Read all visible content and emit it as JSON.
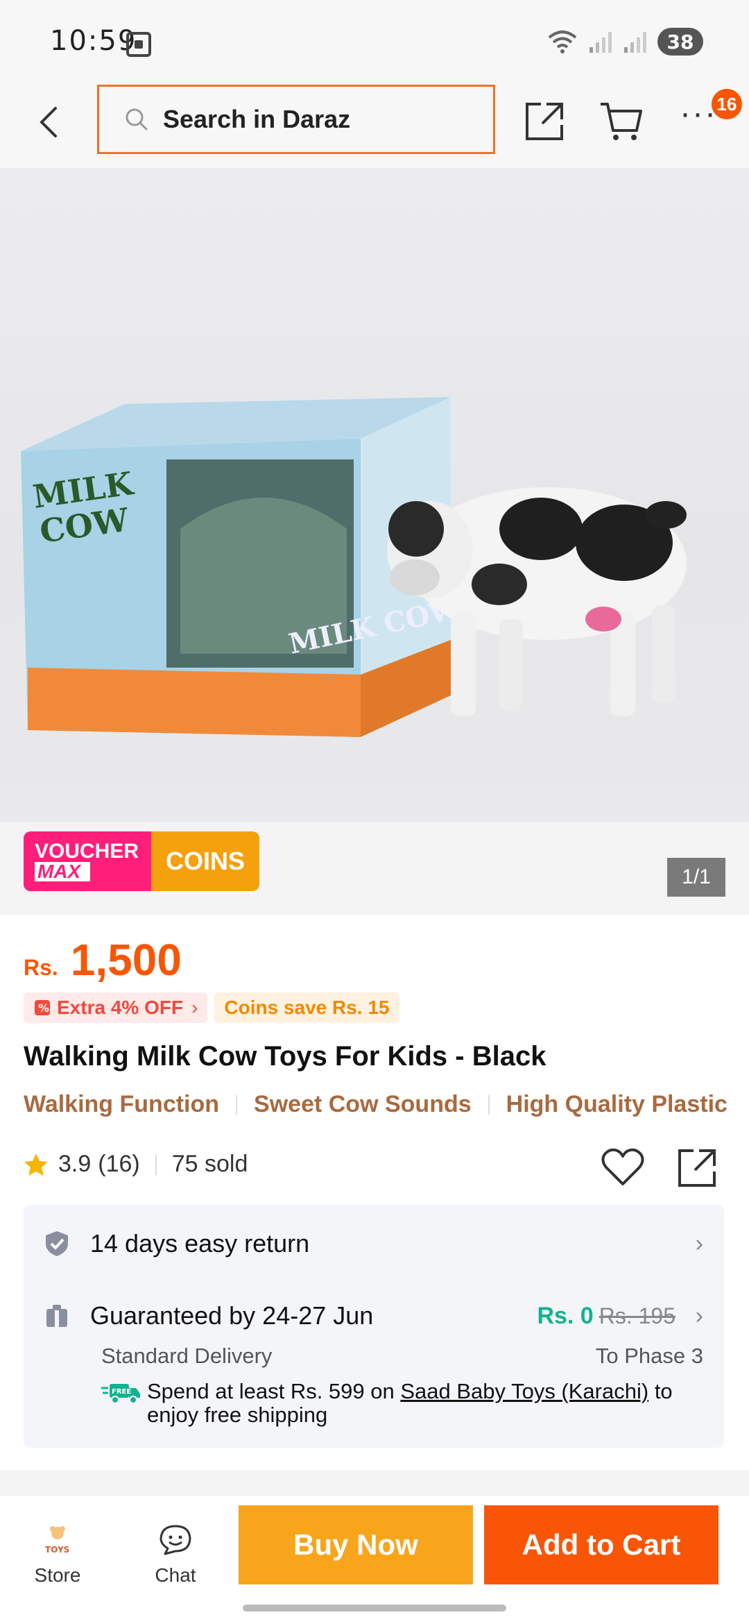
{
  "status_bar": {
    "time": "10:59",
    "battery": "38"
  },
  "header": {
    "search_placeholder": "Search in Daraz",
    "cart_count": "16"
  },
  "product_image": {
    "counter": "1/1",
    "box_text": "MILK COW"
  },
  "voucher_badge": {
    "voucher_line1": "VOUCHER",
    "voucher_line2": "MAX",
    "coins_label": "COINS"
  },
  "price": {
    "currency": "Rs.",
    "value": "1,500"
  },
  "promos": {
    "extra_off": "Extra 4% OFF",
    "coins_save": "Coins save Rs. 15"
  },
  "product": {
    "title": "Walking Milk Cow Toys For Kids - Black",
    "features": [
      "Walking Function",
      "Sweet Cow Sounds",
      "High Quality Plastic"
    ],
    "rating": "3.9",
    "rating_count": "(16)",
    "sold": "75 sold"
  },
  "delivery": {
    "return_label": "14 days easy return",
    "guarantee_label": "Guaranteed by 24-27 Jun",
    "ship_price": "Rs. 0",
    "ship_old_price": "Rs. 195",
    "standard_label": "Standard Delivery",
    "phase_label": "To Phase 3",
    "free_ship_prefix": "Spend at least Rs. 599 on ",
    "free_ship_store": "Saad Baby Toys (Karachi)",
    "free_ship_suffix": " to enjoy free shipping",
    "free_icon_text": "FREE"
  },
  "bottom_bar": {
    "store_label": "Store",
    "chat_label": "Chat",
    "buy_now": "Buy Now",
    "add_to_cart": "Add to Cart",
    "store_logo_text": "TOYS"
  },
  "colors": {
    "brand_orange": "#f85606",
    "buy_now_yellow": "#f9a51b",
    "free_green": "#14b28e",
    "feature_brown": "#a86a3f"
  }
}
